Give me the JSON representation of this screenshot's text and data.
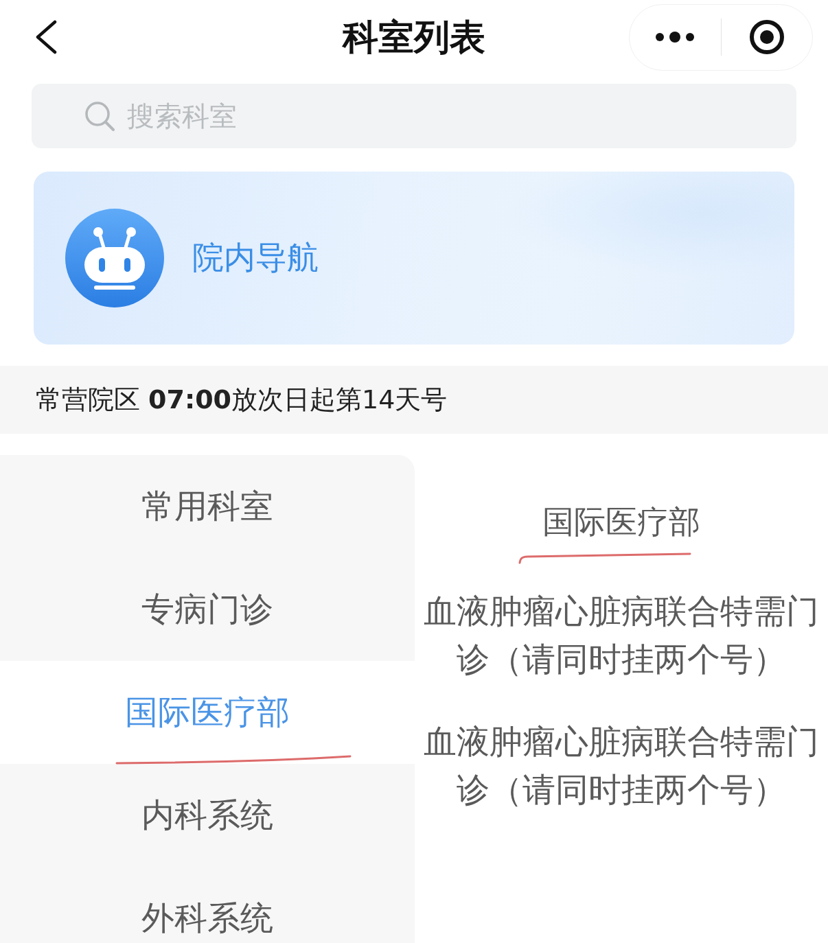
{
  "nav_bar": {
    "title": "科室列表"
  },
  "search": {
    "placeholder": "搜索科室"
  },
  "banner": {
    "label": "院内导航"
  },
  "notice": {
    "text": "常营院区 **07:00**放次日起第14天号"
  },
  "sidebar": {
    "items": [
      {
        "label": "常用科室",
        "selected": false,
        "underlined": false
      },
      {
        "label": "专病门诊",
        "selected": false,
        "underlined": false
      },
      {
        "label": "国际医疗部",
        "selected": true,
        "underlined": true
      },
      {
        "label": "内科系统",
        "selected": false,
        "underlined": false
      },
      {
        "label": "外科系统",
        "selected": false,
        "underlined": false
      }
    ]
  },
  "content": {
    "heading": {
      "text": "国际医疗部",
      "underlined": true
    },
    "items": [
      {
        "label": "血液肿瘤心脏病联合特需门诊（请同时挂两个号）"
      },
      {
        "label": "血液肿瘤心脏病联合特需门诊（请同时挂两个号）"
      }
    ]
  }
}
